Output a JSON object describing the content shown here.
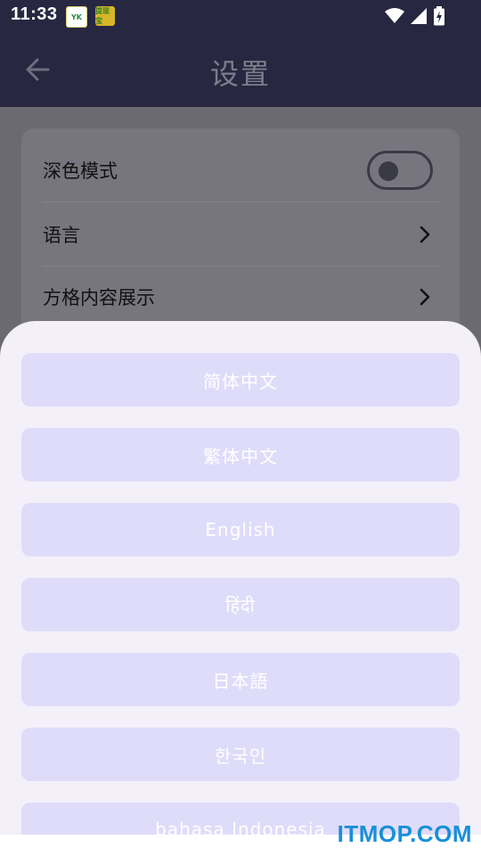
{
  "status_bar": {
    "time": "11:33",
    "notifications": [
      "yk-app-icon",
      "game-app-icon"
    ],
    "notif_yk_text": "YK",
    "notif_game_text": "提现宝",
    "system_icons": [
      "wifi-icon",
      "signal-icon",
      "battery-charging-icon"
    ]
  },
  "app_bar": {
    "title": "设置",
    "back_icon": "arrow-left-icon"
  },
  "settings": {
    "rows": [
      {
        "label": "深色模式",
        "control": "toggle",
        "checked": false
      },
      {
        "label": "语言",
        "control": "chevron-right-icon"
      },
      {
        "label": "方格内容展示",
        "control": "chevron-right-icon"
      }
    ]
  },
  "language_sheet": {
    "options": [
      "简体中文",
      "繁体中文",
      "English",
      "हिंदी",
      "日本語",
      "한국인",
      "bahasa Indonesia"
    ]
  },
  "watermark": "ITMOP.COM",
  "colors": {
    "app_bar_bg": "#272741",
    "sheet_bg": "#f3f0f9",
    "option_bg": "#dfdcfa",
    "watermark": "#1a8fd8"
  }
}
